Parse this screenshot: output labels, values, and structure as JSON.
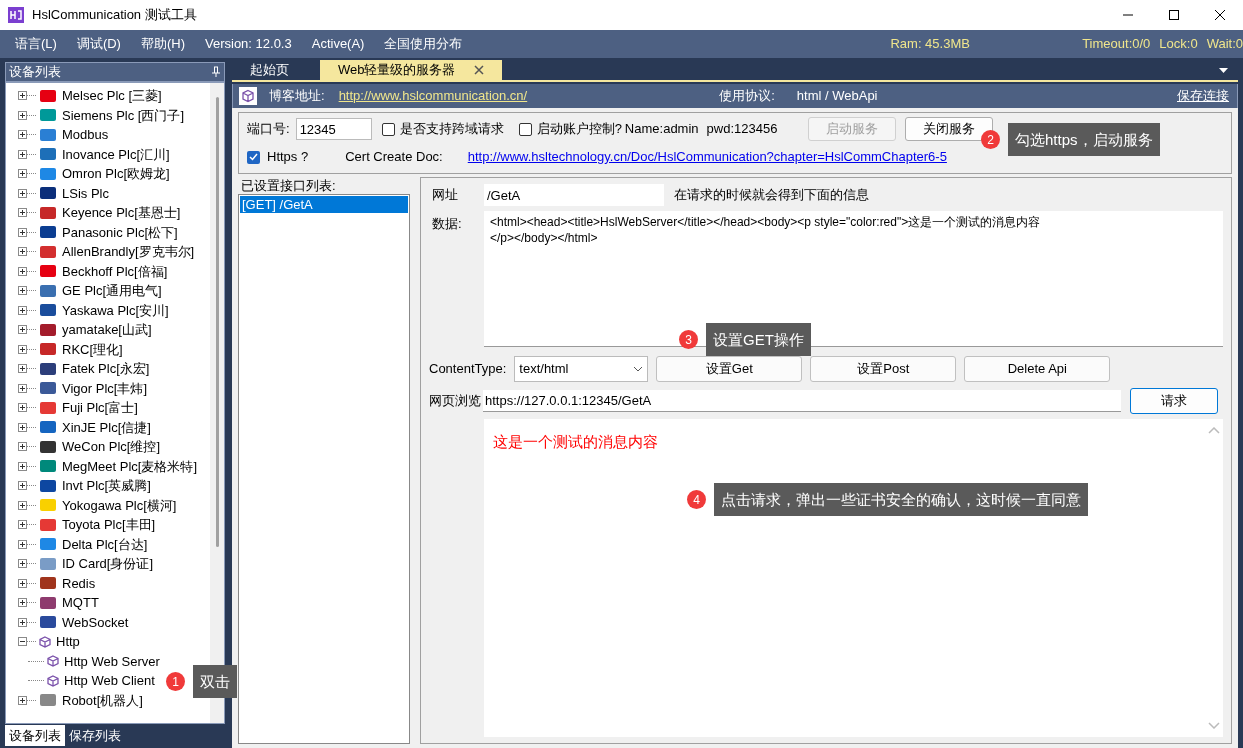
{
  "window": {
    "title": "HslCommunication 测试工具"
  },
  "menu": [
    "语言(L)",
    "调试(D)",
    "帮助(H)",
    "Version: 12.0.3",
    "Active(A)",
    "全国使用分布"
  ],
  "status": {
    "ram": "Ram: 45.3MB",
    "timeout": "Timeout:0/0",
    "lock": "Lock:0",
    "wait": "Wait:0"
  },
  "sidebar": {
    "title": "设备列表",
    "items": [
      {
        "label": "Melsec Plc [三菱]",
        "expanded": false
      },
      {
        "label": "Siemens Plc [西门子]",
        "expanded": false
      },
      {
        "label": "Modbus",
        "expanded": false
      },
      {
        "label": "Inovance Plc[汇川]",
        "expanded": false
      },
      {
        "label": "Omron Plc[欧姆龙]",
        "expanded": false
      },
      {
        "label": "LSis Plc",
        "expanded": false
      },
      {
        "label": "Keyence Plc[基恩士]",
        "expanded": false
      },
      {
        "label": "Panasonic Plc[松下]",
        "expanded": false
      },
      {
        "label": "AllenBrandly[罗克韦尔]",
        "expanded": false
      },
      {
        "label": "Beckhoff Plc[倍福]",
        "expanded": false
      },
      {
        "label": "GE Plc[通用电气]",
        "expanded": false
      },
      {
        "label": "Yaskawa Plc[安川]",
        "expanded": false
      },
      {
        "label": "yamatake[山武]",
        "expanded": false
      },
      {
        "label": "RKC[理化]",
        "expanded": false
      },
      {
        "label": "Fatek Plc[永宏]",
        "expanded": false
      },
      {
        "label": "Vigor Plc[丰炜]",
        "expanded": false
      },
      {
        "label": "Fuji Plc[富士]",
        "expanded": false
      },
      {
        "label": "XinJE Plc[信捷]",
        "expanded": false
      },
      {
        "label": "WeCon Plc[维控]",
        "expanded": false
      },
      {
        "label": "MegMeet Plc[麦格米特]",
        "expanded": false
      },
      {
        "label": "Invt Plc[英威腾]",
        "expanded": false
      },
      {
        "label": "Yokogawa Plc[横河]",
        "expanded": false
      },
      {
        "label": "Toyota Plc[丰田]",
        "expanded": false
      },
      {
        "label": "Delta Plc[台达]",
        "expanded": false
      },
      {
        "label": "ID Card[身份证]",
        "expanded": false
      },
      {
        "label": "Redis",
        "expanded": false
      },
      {
        "label": "MQTT",
        "expanded": false
      },
      {
        "label": "WebSocket",
        "expanded": false
      },
      {
        "label": "Http",
        "expanded": true,
        "children": [
          {
            "label": "Http Web Server"
          },
          {
            "label": "Http Web Client"
          }
        ]
      },
      {
        "label": "Robot[机器人]",
        "expanded": false
      }
    ],
    "tabs": [
      {
        "label": "设备列表",
        "selected": true
      },
      {
        "label": "保存列表",
        "selected": false
      }
    ]
  },
  "doc_tabs": [
    {
      "label": "起始页",
      "selected": false,
      "closable": false
    },
    {
      "label": "Web轻量级的服务器",
      "selected": true,
      "closable": true
    }
  ],
  "header": {
    "blog_label": "博客地址:",
    "blog_url": "http://www.hslcommunication.cn/",
    "protocol_label": "使用协议:",
    "protocol": "html / WebApi",
    "save_link": "保存连接"
  },
  "server": {
    "port_label": "端口号:",
    "port": "12345",
    "options": [
      {
        "label": "是否支持跨域请求",
        "checked": false
      },
      {
        "label": "启动账户控制?",
        "checked": false
      }
    ],
    "account": "Name:admin",
    "password": "pwd:123456",
    "buttons": [
      {
        "label": "启动服务",
        "disabled": true
      },
      {
        "label": "关闭服务",
        "disabled": false
      }
    ],
    "https": {
      "label": "Https ?",
      "checked": true
    },
    "cert_label": "Cert Create Doc:",
    "cert_url": "http://www.hsltechnology.cn/Doc/HslCommunication?chapter=HslCommChapter6-5"
  },
  "api_list": {
    "title": "已设置接口列表:",
    "items": [
      {
        "label": "[GET] /GetA",
        "selected": true
      }
    ]
  },
  "editor": {
    "url_label": "网址",
    "url": "/GetA",
    "url_hint": "在请求的时候就会得到下面的信息",
    "data_label": "数据:",
    "data": "<html><head><title>HslWebServer</title></head><body><p style=\"color:red\">这是一个测试的消息内容\n</p></body></html>",
    "content_type_label": "ContentType:",
    "content_type": "text/html",
    "actions": [
      "设置Get",
      "设置Post",
      "Delete Api"
    ]
  },
  "browser": {
    "label": "网页浏览",
    "url": "https://127.0.0.1:12345/GetA",
    "request": "请求",
    "content": "这是一个测试的消息内容"
  },
  "annotations": [
    {
      "number": "1",
      "text": "双击"
    },
    {
      "number": "2",
      "text": "勾选https，启动服务"
    },
    {
      "number": "3",
      "text": "设置GET操作"
    },
    {
      "number": "4",
      "text": "点击请求，弹出一些证书安全的确认，这时候一直同意"
    }
  ]
}
